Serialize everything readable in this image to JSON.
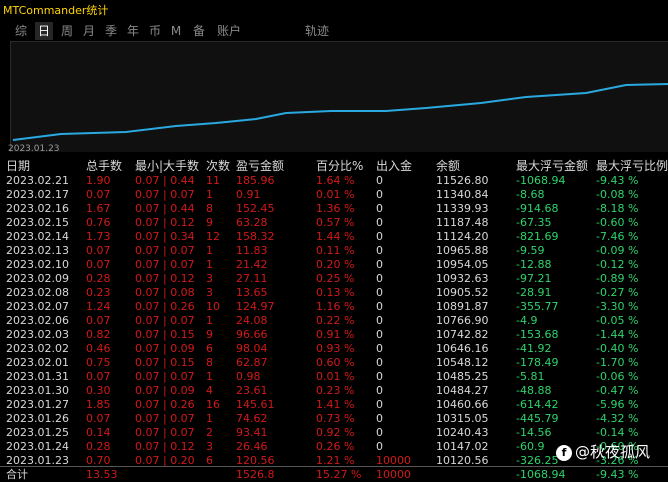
{
  "window": {
    "title": "MTCommander统计"
  },
  "tabs": [
    {
      "label": "综",
      "active": false
    },
    {
      "label": "日",
      "active": true
    },
    {
      "label": "周",
      "active": false
    },
    {
      "label": "月",
      "active": false
    },
    {
      "label": "季",
      "active": false
    },
    {
      "label": "年",
      "active": false
    },
    {
      "label": "币",
      "active": false
    },
    {
      "label": "M",
      "active": false
    },
    {
      "label": "备",
      "active": false
    },
    {
      "label": "账户",
      "active": false
    },
    {
      "label": "轨迹",
      "active": false
    }
  ],
  "chart": {
    "start_label": "2023.01.23",
    "line_color": "#29a9e0"
  },
  "columns": [
    "日期",
    "总手数",
    "最小|大手数",
    "次数",
    "盈亏金额",
    "百分比%",
    "出入金",
    "余额",
    "最大浮亏金额",
    "最大浮亏比例"
  ],
  "rows": [
    {
      "date": "2023.02.21",
      "lots": "1.90",
      "minmax": "0.07 | 0.44",
      "count": "11",
      "pnl": "185.96",
      "pct": "1.64 %",
      "flow": "0",
      "balance": "11526.80",
      "maxloss": "-1068.94",
      "maxlosspct": "-9.43 %"
    },
    {
      "date": "2023.02.17",
      "lots": "0.07",
      "minmax": "0.07 | 0.07",
      "count": "1",
      "pnl": "0.91",
      "pct": "0.01 %",
      "flow": "0",
      "balance": "11340.84",
      "maxloss": "-8.68",
      "maxlosspct": "-0.08 %"
    },
    {
      "date": "2023.02.16",
      "lots": "1.67",
      "minmax": "0.07 | 0.44",
      "count": "8",
      "pnl": "152.45",
      "pct": "1.36 %",
      "flow": "0",
      "balance": "11339.93",
      "maxloss": "-914.68",
      "maxlosspct": "-8.18 %"
    },
    {
      "date": "2023.02.15",
      "lots": "0.76",
      "minmax": "0.07 | 0.12",
      "count": "9",
      "pnl": "63.28",
      "pct": "0.57 %",
      "flow": "0",
      "balance": "11187.48",
      "maxloss": "-67.35",
      "maxlosspct": "-0.60 %"
    },
    {
      "date": "2023.02.14",
      "lots": "1.73",
      "minmax": "0.07 | 0.34",
      "count": "12",
      "pnl": "158.32",
      "pct": "1.44 %",
      "flow": "0",
      "balance": "11124.20",
      "maxloss": "-821.69",
      "maxlosspct": "-7.46 %"
    },
    {
      "date": "2023.02.13",
      "lots": "0.07",
      "minmax": "0.07 | 0.07",
      "count": "1",
      "pnl": "11.83",
      "pct": "0.11 %",
      "flow": "0",
      "balance": "10965.88",
      "maxloss": "-9.59",
      "maxlosspct": "-0.09 %"
    },
    {
      "date": "2023.02.10",
      "lots": "0.07",
      "minmax": "0.07 | 0.07",
      "count": "1",
      "pnl": "21.42",
      "pct": "0.20 %",
      "flow": "0",
      "balance": "10954.05",
      "maxloss": "-12.88",
      "maxlosspct": "-0.12 %"
    },
    {
      "date": "2023.02.09",
      "lots": "0.28",
      "minmax": "0.07 | 0.12",
      "count": "3",
      "pnl": "27.11",
      "pct": "0.25 %",
      "flow": "0",
      "balance": "10932.63",
      "maxloss": "-97.21",
      "maxlosspct": "-0.89 %"
    },
    {
      "date": "2023.02.08",
      "lots": "0.23",
      "minmax": "0.07 | 0.08",
      "count": "3",
      "pnl": "13.65",
      "pct": "0.13 %",
      "flow": "0",
      "balance": "10905.52",
      "maxloss": "-28.91",
      "maxlosspct": "-0.27 %"
    },
    {
      "date": "2023.02.07",
      "lots": "1.24",
      "minmax": "0.07 | 0.26",
      "count": "10",
      "pnl": "124.97",
      "pct": "1.16 %",
      "flow": "0",
      "balance": "10891.87",
      "maxloss": "-355.77",
      "maxlosspct": "-3.30 %"
    },
    {
      "date": "2023.02.06",
      "lots": "0.07",
      "minmax": "0.07 | 0.07",
      "count": "1",
      "pnl": "24.08",
      "pct": "0.22 %",
      "flow": "0",
      "balance": "10766.90",
      "maxloss": "-4.9",
      "maxlosspct": "-0.05 %"
    },
    {
      "date": "2023.02.03",
      "lots": "0.82",
      "minmax": "0.07 | 0.15",
      "count": "9",
      "pnl": "96.66",
      "pct": "0.91 %",
      "flow": "0",
      "balance": "10742.82",
      "maxloss": "-153.68",
      "maxlosspct": "-1.44 %"
    },
    {
      "date": "2023.02.02",
      "lots": "0.46",
      "minmax": "0.07 | 0.09",
      "count": "6",
      "pnl": "98.04",
      "pct": "0.93 %",
      "flow": "0",
      "balance": "10646.16",
      "maxloss": "-41.92",
      "maxlosspct": "-0.40 %"
    },
    {
      "date": "2023.02.01",
      "lots": "0.75",
      "minmax": "0.07 | 0.15",
      "count": "8",
      "pnl": "62.87",
      "pct": "0.60 %",
      "flow": "0",
      "balance": "10548.12",
      "maxloss": "-178.49",
      "maxlosspct": "-1.70 %"
    },
    {
      "date": "2023.01.31",
      "lots": "0.07",
      "minmax": "0.07 | 0.07",
      "count": "1",
      "pnl": "0.98",
      "pct": "0.01 %",
      "flow": "0",
      "balance": "10485.25",
      "maxloss": "-5.81",
      "maxlosspct": "-0.06 %"
    },
    {
      "date": "2023.01.30",
      "lots": "0.30",
      "minmax": "0.07 | 0.09",
      "count": "4",
      "pnl": "23.61",
      "pct": "0.23 %",
      "flow": "0",
      "balance": "10484.27",
      "maxloss": "-48.88",
      "maxlosspct": "-0.47 %"
    },
    {
      "date": "2023.01.27",
      "lots": "1.85",
      "minmax": "0.07 | 0.26",
      "count": "16",
      "pnl": "145.61",
      "pct": "1.41 %",
      "flow": "0",
      "balance": "10460.66",
      "maxloss": "-614.42",
      "maxlosspct": "-5.96 %"
    },
    {
      "date": "2023.01.26",
      "lots": "0.07",
      "minmax": "0.07 | 0.07",
      "count": "1",
      "pnl": "74.62",
      "pct": "0.73 %",
      "flow": "0",
      "balance": "10315.05",
      "maxloss": "-445.79",
      "maxlosspct": "-4.32 %"
    },
    {
      "date": "2023.01.25",
      "lots": "0.14",
      "minmax": "0.07 | 0.07",
      "count": "2",
      "pnl": "93.41",
      "pct": "0.92 %",
      "flow": "0",
      "balance": "10240.43",
      "maxloss": "-14.56",
      "maxlosspct": "-0.14 %"
    },
    {
      "date": "2023.01.24",
      "lots": "0.28",
      "minmax": "0.07 | 0.12",
      "count": "3",
      "pnl": "26.46",
      "pct": "0.26 %",
      "flow": "0",
      "balance": "10147.02",
      "maxloss": "-60.9",
      "maxlosspct": "-0.60 %"
    },
    {
      "date": "2023.01.23",
      "lots": "0.70",
      "minmax": "0.07 | 0.20",
      "count": "6",
      "pnl": "120.56",
      "pct": "1.21 %",
      "flow": "10000",
      "balance": "10120.56",
      "maxloss": "-326.25",
      "maxlosspct": "-3.26 %"
    }
  ],
  "total": {
    "label": "合计",
    "lots": "13.53",
    "pnl": "1526.8",
    "pct": "15.27 %",
    "flow": "10000",
    "maxloss": "-1068.94",
    "maxlosspct": "-9.43 %"
  },
  "watermark": {
    "logo": "f",
    "text": "@秋夜孤风"
  },
  "colors": {
    "accent": "#ffd400",
    "loss": "#2fd36b",
    "red": "#d21919",
    "line": "#29a9e0"
  }
}
